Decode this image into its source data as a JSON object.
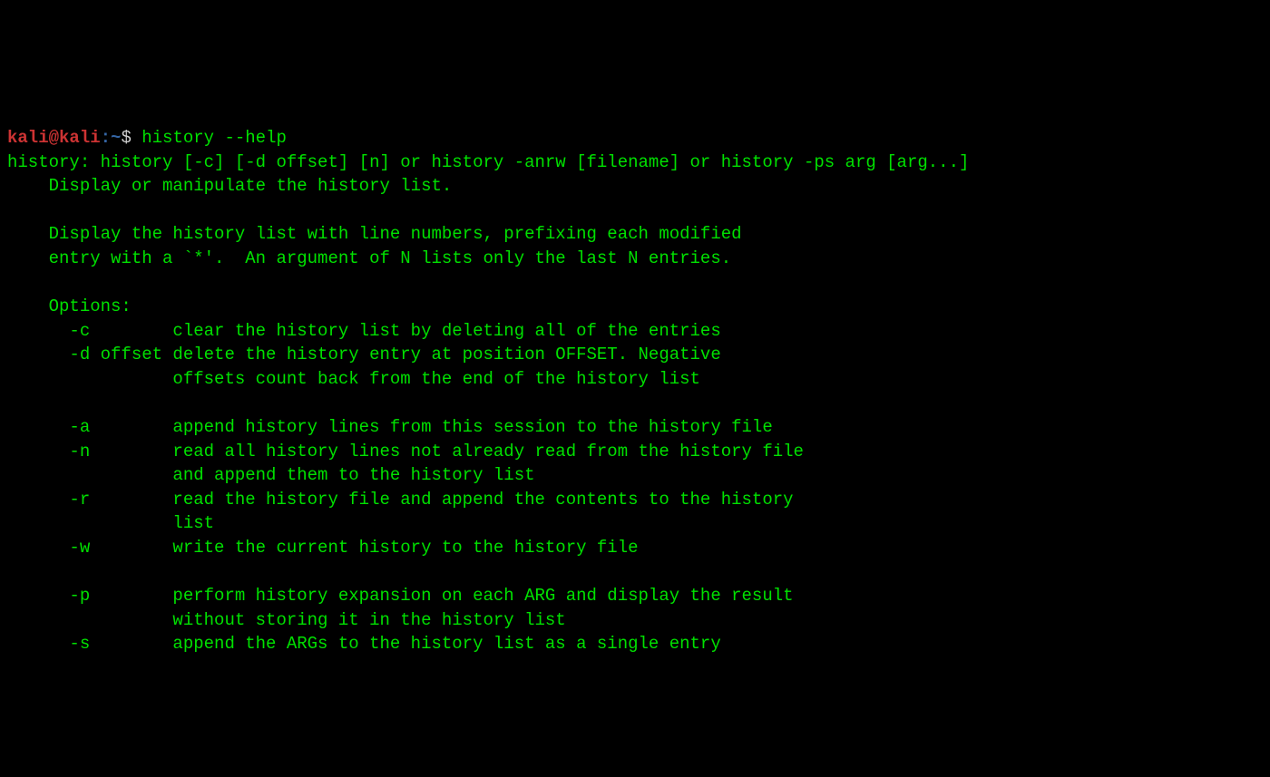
{
  "prompt": {
    "user": "kali",
    "at": "@",
    "host": "kali",
    "colon": ":",
    "path": "~",
    "dollar": "$ ",
    "command": "history --help"
  },
  "output": {
    "line1": "history: history [-c] [-d offset] [n] or history -anrw [filename] or history -ps arg [arg...]",
    "line2": "    Display or manipulate the history list.",
    "line3": "    ",
    "line4": "    Display the history list with line numbers, prefixing each modified",
    "line5": "    entry with a `*'.  An argument of N lists only the last N entries.",
    "line6": "    ",
    "line7": "    Options:",
    "line8": "      -c        clear the history list by deleting all of the entries",
    "line9": "      -d offset delete the history entry at position OFFSET. Negative",
    "line10": "                offsets count back from the end of the history list",
    "line11": "    ",
    "line12": "      -a        append history lines from this session to the history file",
    "line13": "      -n        read all history lines not already read from the history file",
    "line14": "                and append them to the history list",
    "line15": "      -r        read the history file and append the contents to the history",
    "line16": "                list",
    "line17": "      -w        write the current history to the history file",
    "line18": "    ",
    "line19": "      -p        perform history expansion on each ARG and display the result",
    "line20": "                without storing it in the history list",
    "line21": "      -s        append the ARGs to the history list as a single entry"
  }
}
